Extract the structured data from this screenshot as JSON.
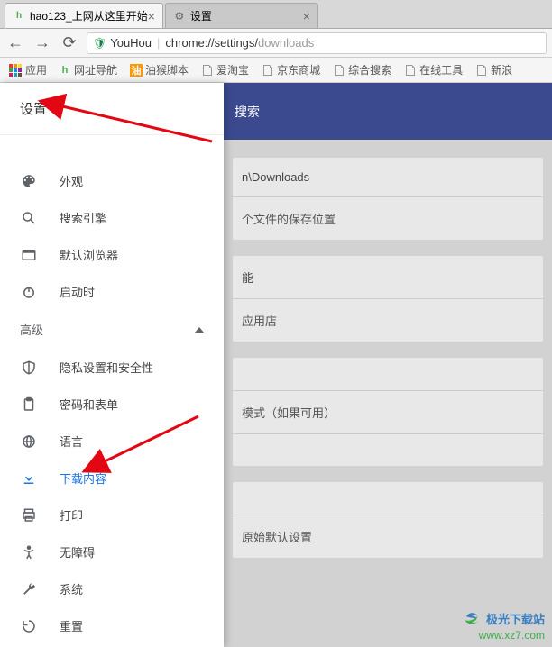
{
  "tabs": {
    "t0": {
      "title": "hao123_上网从这里开始"
    },
    "t1": {
      "title": "设置"
    }
  },
  "toolbar": {
    "brand": "YouHou",
    "url_dark": "chrome://settings/",
    "url_light": "downloads"
  },
  "bookmarks": {
    "apps": "应用",
    "b0": "网址导航",
    "b1": "油猴脚本",
    "b2": "爱淘宝",
    "b3": "京东商城",
    "b4": "综合搜索",
    "b5": "在线工具",
    "b6": "新浪"
  },
  "header_search": "搜索",
  "sidebar": {
    "title": "设置",
    "items": {
      "appearance": "外观",
      "search": "搜索引擎",
      "default_browser": "默认浏览器",
      "startup": "启动时",
      "advanced": "高级",
      "privacy": "隐私设置和安全性",
      "passwords": "密码和表单",
      "language": "语言",
      "downloads": "下载内容",
      "print": "打印",
      "accessibility": "无障碍",
      "system": "系统",
      "reset": "重置"
    }
  },
  "page": {
    "card1": {
      "r1": "n\\Downloads",
      "r2": "个文件的保存位置"
    },
    "card2": {
      "r1": "能",
      "r2": "应用店"
    },
    "card3": {
      "r1": "模式（如果可用）"
    },
    "card4": {
      "r1": "原始默认设置"
    }
  },
  "watermark": {
    "brand": "极光下载站",
    "url": "www.xz7.com"
  }
}
